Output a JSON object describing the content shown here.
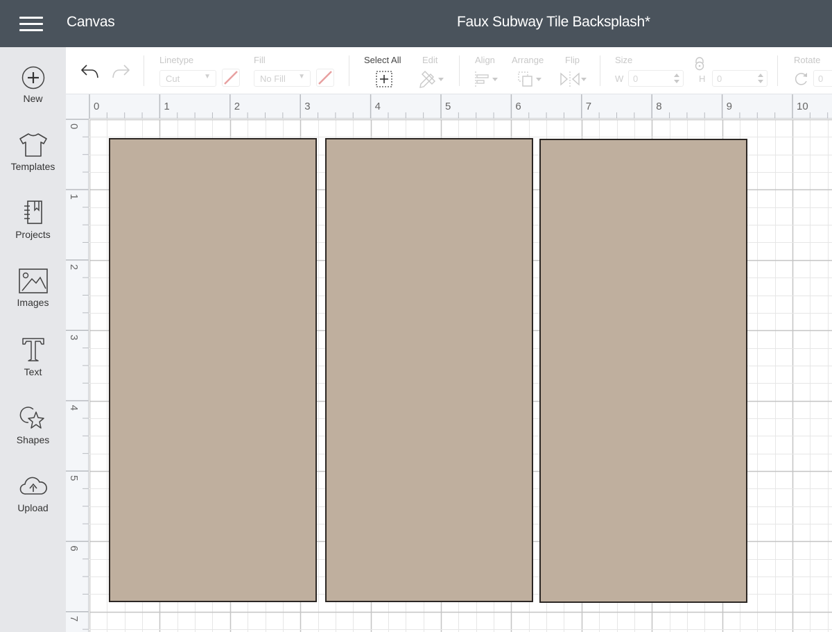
{
  "topbar": {
    "menu_icon": "hamburger-menu-icon",
    "app_title": "Canvas",
    "document_title": "Faux Subway Tile Backsplash*"
  },
  "sidebar": {
    "items": [
      {
        "label": "New",
        "icon": "plus-circle-icon"
      },
      {
        "label": "Templates",
        "icon": "tshirt-icon"
      },
      {
        "label": "Projects",
        "icon": "notebook-icon"
      },
      {
        "label": "Images",
        "icon": "image-icon"
      },
      {
        "label": "Text",
        "icon": "text-t-icon"
      },
      {
        "label": "Shapes",
        "icon": "shapes-icon"
      },
      {
        "label": "Upload",
        "icon": "cloud-upload-icon"
      }
    ]
  },
  "toolbar": {
    "undo_icon": "undo-icon",
    "redo_icon": "redo-icon",
    "linetype": {
      "label": "Linetype",
      "value": "Cut"
    },
    "fill": {
      "label": "Fill",
      "value": "No Fill"
    },
    "select_all": {
      "label": "Select All"
    },
    "edit": {
      "label": "Edit"
    },
    "align": {
      "label": "Align"
    },
    "arrange": {
      "label": "Arrange"
    },
    "flip": {
      "label": "Flip"
    },
    "size": {
      "label": "Size",
      "w_label": "W",
      "w_value": "0",
      "h_label": "H",
      "h_value": "0"
    },
    "rotate": {
      "label": "Rotate",
      "value": "0"
    }
  },
  "rulers": {
    "unit": "in",
    "horizontal_labels": [
      "0",
      "1",
      "2",
      "3",
      "4",
      "5",
      "6",
      "7",
      "8",
      "9",
      "10"
    ],
    "vertical_labels": [
      "0",
      "1",
      "2",
      "3",
      "4",
      "5",
      "6",
      "7"
    ]
  },
  "canvas": {
    "tiles": [
      {
        "name": "tile-1",
        "x_in": 0.28,
        "y_in": 0.27,
        "w_in": 2.96,
        "h_in": 6.6,
        "fill": "#bfaf9e"
      },
      {
        "name": "tile-2",
        "x_in": 3.35,
        "y_in": 0.27,
        "w_in": 2.96,
        "h_in": 6.6,
        "fill": "#bfaf9e"
      },
      {
        "name": "tile-3",
        "x_in": 6.4,
        "y_in": 0.28,
        "w_in": 2.96,
        "h_in": 6.6,
        "fill": "#bfaf9e"
      }
    ]
  },
  "colors": {
    "topbar_bg": "#4a535c",
    "sidebar_bg": "#e6e7ea",
    "tile_fill": "#bfaf9e",
    "tile_stroke": "#2b2623",
    "disabled_red": "#e8a0a0"
  }
}
